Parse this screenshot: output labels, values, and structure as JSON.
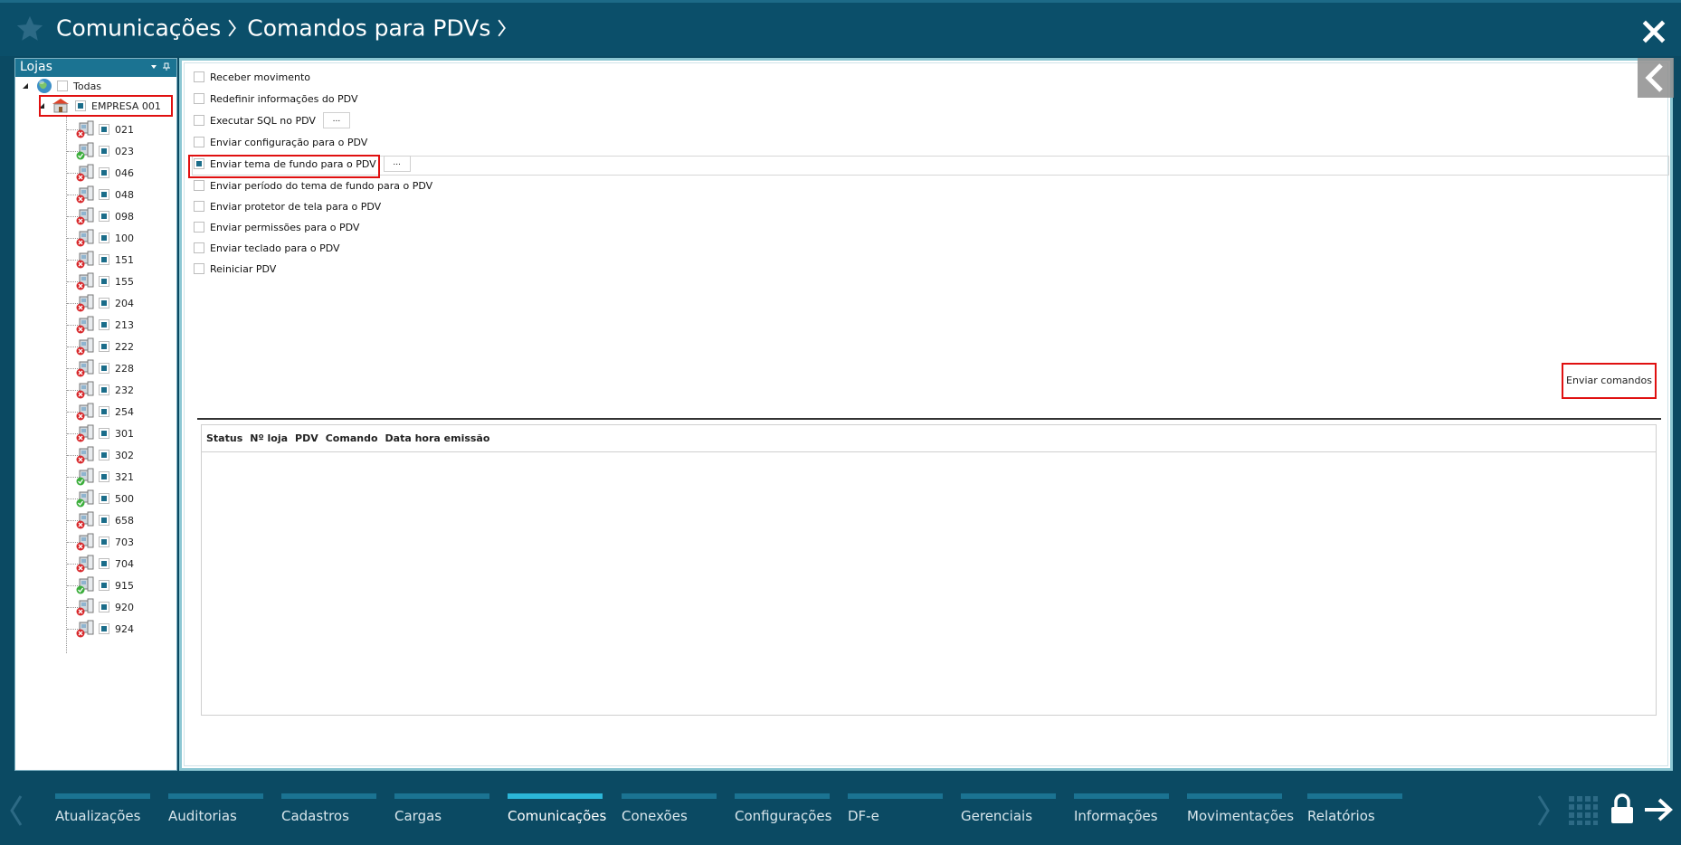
{
  "header": {
    "crumbs": [
      "Comunicações",
      "Comandos para PDVs"
    ]
  },
  "left_panel": {
    "title": "Lojas",
    "root_label": "Todas",
    "company_label": "EMPRESA 001",
    "pdvs": [
      {
        "id": "021",
        "status": "error"
      },
      {
        "id": "023",
        "status": "ok"
      },
      {
        "id": "046",
        "status": "error"
      },
      {
        "id": "048",
        "status": "error"
      },
      {
        "id": "098",
        "status": "error"
      },
      {
        "id": "100",
        "status": "error"
      },
      {
        "id": "151",
        "status": "error"
      },
      {
        "id": "155",
        "status": "error"
      },
      {
        "id": "204",
        "status": "error"
      },
      {
        "id": "213",
        "status": "error"
      },
      {
        "id": "222",
        "status": "error"
      },
      {
        "id": "228",
        "status": "error"
      },
      {
        "id": "232",
        "status": "error"
      },
      {
        "id": "254",
        "status": "error"
      },
      {
        "id": "301",
        "status": "error"
      },
      {
        "id": "302",
        "status": "error"
      },
      {
        "id": "321",
        "status": "ok"
      },
      {
        "id": "500",
        "status": "ok"
      },
      {
        "id": "658",
        "status": "error"
      },
      {
        "id": "703",
        "status": "error"
      },
      {
        "id": "704",
        "status": "error"
      },
      {
        "id": "915",
        "status": "ok"
      },
      {
        "id": "920",
        "status": "error"
      },
      {
        "id": "924",
        "status": "error"
      }
    ]
  },
  "commands": {
    "options": [
      {
        "label": "Receber movimento",
        "checked": false,
        "has_dots": false
      },
      {
        "label": "Redefinir informações do PDV",
        "checked": false,
        "has_dots": false
      },
      {
        "label": "Executar SQL no PDV",
        "checked": false,
        "has_dots": true
      },
      {
        "label": "Enviar configuração para o PDV",
        "checked": false,
        "has_dots": false
      },
      {
        "label": "Enviar tema de fundo para o PDV",
        "checked": true,
        "has_dots": true
      },
      {
        "label": "Enviar período do tema de fundo para o PDV",
        "checked": false,
        "has_dots": false
      },
      {
        "label": "Enviar protetor de tela para o PDV",
        "checked": false,
        "has_dots": false
      },
      {
        "label": "Enviar permissões para o PDV",
        "checked": false,
        "has_dots": false
      },
      {
        "label": "Enviar teclado para o PDV",
        "checked": false,
        "has_dots": false
      },
      {
        "label": "Reiniciar PDV",
        "checked": false,
        "has_dots": false
      }
    ],
    "dots_label": "...",
    "send_button": "Enviar comandos"
  },
  "grid": {
    "columns": [
      "Status",
      "Nº loja",
      "PDV",
      "Comando",
      "Data hora emissão"
    ]
  },
  "bottom_nav": {
    "items": [
      "Atualizações",
      "Auditorias",
      "Cadastros",
      "Cargas",
      "Comunicações",
      "Conexões",
      "Configurações",
      "DF-e",
      "Gerenciais",
      "Informações",
      "Movimentações",
      "Relatórios"
    ],
    "active": "Comunicações"
  },
  "colors": {
    "background": "#0b4a63",
    "nav_bar": "#1b7392",
    "nav_active": "#2bb6d8",
    "highlight": "#e01010"
  }
}
